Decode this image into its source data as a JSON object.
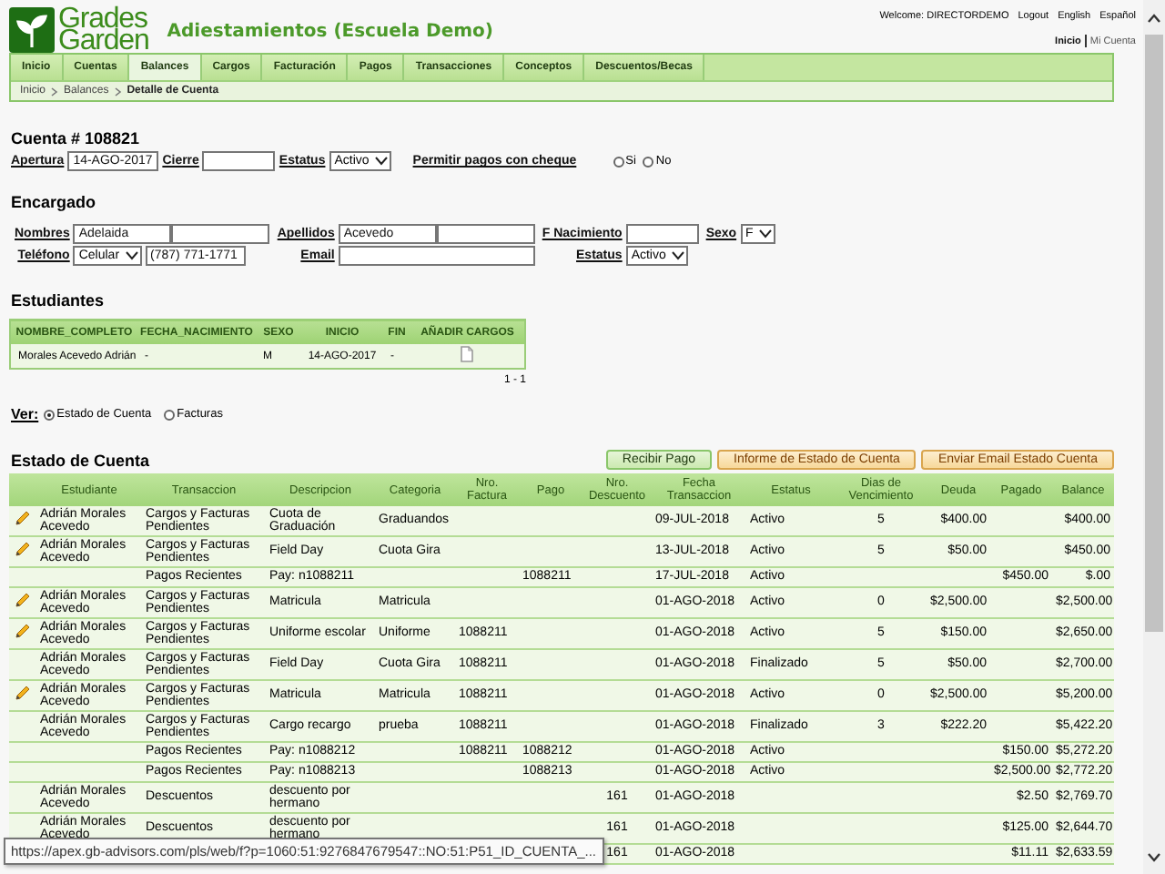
{
  "header": {
    "logo": [
      "Grades",
      "Garden"
    ],
    "app_title": "Adiestamientos (Escuela Demo)",
    "welcome": "Welcome: DIRECTORDEMO",
    "user_links": [
      "Logout",
      "English",
      "Español"
    ],
    "account_links": [
      {
        "label": "Inicio",
        "selected": true
      },
      {
        "label": "Mi Cuenta",
        "selected": false
      }
    ]
  },
  "nav": {
    "tabs": [
      {
        "label": "Inicio",
        "selected": false
      },
      {
        "label": "Cuentas",
        "selected": false
      },
      {
        "label": "Balances",
        "selected": true
      },
      {
        "label": "Cargos",
        "selected": false
      },
      {
        "label": "Facturación",
        "selected": false
      },
      {
        "label": "Pagos",
        "selected": false
      },
      {
        "label": "Transacciones",
        "selected": false
      },
      {
        "label": "Conceptos",
        "selected": false
      },
      {
        "label": "Descuentos/Becas",
        "selected": false
      }
    ],
    "breadcrumb": [
      {
        "label": "Inicio",
        "current": false
      },
      {
        "label": "Balances",
        "current": false
      },
      {
        "label": "Detalle de Cuenta",
        "current": true
      }
    ]
  },
  "cuenta": {
    "title": "Cuenta # 108821",
    "fields": [
      {
        "kind": "date",
        "label": "Apertura",
        "value": "14-AGO-2017"
      },
      {
        "kind": "text",
        "label": "Cierre"
      },
      {
        "kind": "select",
        "label": "Estatus",
        "value": "Activo"
      },
      {
        "kind": "radio",
        "label": "Permitir pagos con cheque",
        "options": [
          {
            "label": "Si",
            "selected": false
          },
          {
            "label": "No",
            "selected": false
          }
        ]
      }
    ]
  },
  "encargado": {
    "title": "Encargado",
    "fields": [
      {
        "kind": "double",
        "label": "Nombres",
        "value": "Adelaida"
      },
      {
        "kind": "double",
        "label": "Apellidos",
        "value": "Acevedo"
      },
      {
        "kind": "text",
        "label": "F Nacimiento"
      },
      {
        "kind": "select",
        "label": "Sexo",
        "value": "F"
      },
      {
        "kind": "phone",
        "label": "Teléfono",
        "type": "Celular",
        "value": "(787) 771-1771"
      },
      {
        "kind": "wide",
        "label": "Email"
      },
      {
        "kind": "select",
        "label": "Estatus",
        "value": "Activo"
      }
    ]
  },
  "estudiantes": {
    "title": "Estudiantes",
    "columns": [
      "NOMBRE_COMPLETO",
      "FECHA_NACIMIENTO",
      "SEXO",
      "INICIO",
      "FIN",
      "AÑADIR CARGOS"
    ],
    "rows": [
      {
        "cells": [
          "Morales Acevedo Adrián",
          "-",
          "M",
          "14-AGO-2017",
          "-"
        ]
      }
    ],
    "pagination": "1 - 1"
  },
  "ver": {
    "label": "Ver:",
    "options": [
      {
        "label": "Estado de Cuenta",
        "selected": true
      },
      {
        "label": "Facturas",
        "selected": false
      }
    ]
  },
  "estado": {
    "title": "Estado de Cuenta",
    "buttons": [
      {
        "label": "Recibir Pago",
        "kind": "primary"
      },
      {
        "label": "Informe de Estado de Cuenta",
        "kind": "secondary"
      },
      {
        "label": "Enviar Email Estado Cuenta",
        "kind": "secondary"
      }
    ],
    "columns": [
      "Estudiante",
      "Transaccion",
      "Descripcion",
      "Categoria",
      "Nro. Factura",
      "Pago",
      "Nro. Descuento",
      "Fecha Transaccion",
      "Estatus",
      "Dias de Vencimiento",
      "Deuda",
      "Pagado",
      "Balance"
    ],
    "rows": [
      {
        "editable": true,
        "estudiante": "Adrián Morales Acevedo",
        "transaccion": "Cargos y Facturas Pendientes",
        "descripcion": "Cuota de Graduación",
        "categoria": "Graduandos",
        "fecha": "09-JUL-2018",
        "estatus": "Activo",
        "dias": "5",
        "deuda": "$400.00",
        "balance": "$400.00"
      },
      {
        "editable": true,
        "estudiante": "Adrián Morales Acevedo",
        "transaccion": "Cargos y Facturas Pendientes",
        "descripcion": "Field Day",
        "categoria": "Cuota Gira",
        "fecha": "13-JUL-2018",
        "estatus": "Activo",
        "dias": "5",
        "deuda": "$50.00",
        "balance": "$450.00"
      },
      {
        "editable": false,
        "transaccion": "Pagos Recientes",
        "descripcion": "Pay: n1088211",
        "pago": "1088211",
        "fecha": "17-JUL-2018",
        "estatus": "Activo",
        "pagado": "$450.00",
        "balance": "$.00"
      },
      {
        "editable": true,
        "estudiante": "Adrián Morales Acevedo",
        "transaccion": "Cargos y Facturas Pendientes",
        "descripcion": "Matricula",
        "categoria": "Matricula",
        "fecha": "01-AGO-2018",
        "estatus": "Activo",
        "dias": "0",
        "deuda": "$2,500.00",
        "balance": "$2,500.00"
      },
      {
        "editable": true,
        "estudiante": "Adrián Morales Acevedo",
        "transaccion": "Cargos y Facturas Pendientes",
        "descripcion": "Uniforme escolar",
        "categoria": "Uniforme",
        "factura": "1088211",
        "fecha": "01-AGO-2018",
        "estatus": "Activo",
        "dias": "5",
        "deuda": "$150.00",
        "balance": "$2,650.00"
      },
      {
        "editable": false,
        "estudiante": "Adrián Morales Acevedo",
        "transaccion": "Cargos y Facturas Pendientes",
        "descripcion": "Field Day",
        "categoria": "Cuota Gira",
        "factura": "1088211",
        "fecha": "01-AGO-2018",
        "estatus": "Finalizado",
        "dias": "5",
        "deuda": "$50.00",
        "balance": "$2,700.00"
      },
      {
        "editable": true,
        "estudiante": "Adrián Morales Acevedo",
        "transaccion": "Cargos y Facturas Pendientes",
        "descripcion": "Matricula",
        "categoria": "Matricula",
        "factura": "1088211",
        "fecha": "01-AGO-2018",
        "estatus": "Activo",
        "dias": "0",
        "deuda": "$2,500.00",
        "balance": "$5,200.00"
      },
      {
        "editable": false,
        "estudiante": "Adrián Morales Acevedo",
        "transaccion": "Cargos y Facturas Pendientes",
        "descripcion": "Cargo recargo",
        "categoria": "prueba",
        "factura": "1088211",
        "fecha": "01-AGO-2018",
        "estatus": "Finalizado",
        "dias": "3",
        "deuda": "$222.20",
        "balance": "$5,422.20"
      },
      {
        "editable": false,
        "transaccion": "Pagos Recientes",
        "descripcion": "Pay: n1088212",
        "factura": "1088211",
        "pago": "1088212",
        "fecha": "01-AGO-2018",
        "estatus": "Activo",
        "pagado": "$150.00",
        "balance": "$5,272.20"
      },
      {
        "editable": false,
        "transaccion": "Pagos Recientes",
        "descripcion": "Pay: n1088213",
        "pago": "1088213",
        "fecha": "01-AGO-2018",
        "estatus": "Activo",
        "pagado": "$2,500.00",
        "balance": "$2,772.20"
      },
      {
        "editable": false,
        "estudiante": "Adrián Morales Acevedo",
        "transaccion": "Descuentos",
        "descripcion": "descuento por hermano",
        "descuento": "161",
        "fecha": "01-AGO-2018",
        "pagado": "$2.50",
        "balance": "$2,769.70"
      },
      {
        "editable": false,
        "estudiante": "Adrián Morales Acevedo",
        "transaccion": "Descuentos",
        "descripcion": "descuento por hermano",
        "descuento": "161",
        "fecha": "01-AGO-2018",
        "pagado": "$125.00",
        "balance": "$2,644.70"
      },
      {
        "descuento": "161",
        "fecha": "01-AGO-2018",
        "pagado": "$11.11",
        "balance": "$2,633.59"
      }
    ]
  },
  "status_bar": {
    "url": "https://apex.gb-advisors.com/pls/web/f?p=1060:51:9276847679547::NO:51:P51_ID_CUENTA_..."
  }
}
